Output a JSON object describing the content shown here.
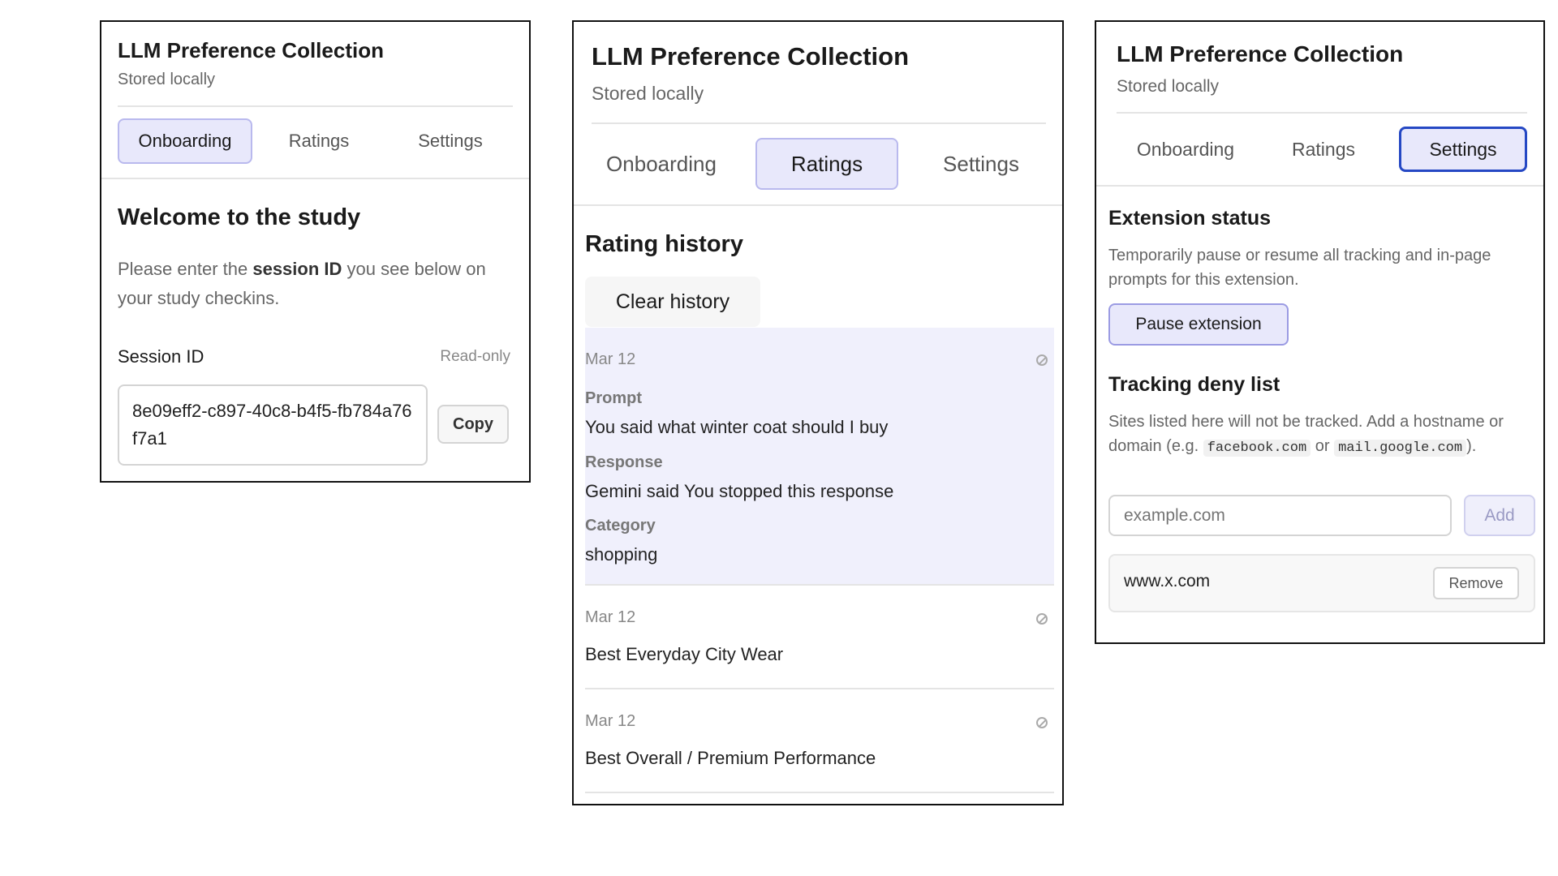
{
  "app": {
    "title": "LLM Preference Collection",
    "subtitle": "Stored locally"
  },
  "tabs": [
    "Onboarding",
    "Ratings",
    "Settings"
  ],
  "onboarding": {
    "heading": "Welcome to the study",
    "text_before": "Please enter the ",
    "text_bold": "session ID",
    "text_after": " you see below on your study checkins.",
    "session_label": "Session ID",
    "readonly_label": "Read-only",
    "session_value": "8e09eff2-c897-40c8-b4f5-fb784a76f7a1",
    "copy_label": "Copy"
  },
  "ratings": {
    "heading": "Rating history",
    "clear_label": "Clear history",
    "items": [
      {
        "date": "Mar 12",
        "prompt_label": "Prompt",
        "prompt": "You said what winter coat should I buy",
        "response_label": "Response",
        "response": "Gemini said You stopped this response",
        "category_label": "Category",
        "category": "shopping"
      },
      {
        "date": "Mar 12",
        "text": "Best Everyday City Wear"
      },
      {
        "date": "Mar 12",
        "text": "Best Overall / Premium Performance"
      }
    ]
  },
  "settings": {
    "status_heading": "Extension status",
    "status_text": "Temporarily pause or resume all tracking and in-page prompts for this extension.",
    "pause_label": "Pause extension",
    "deny_heading": "Tracking deny list",
    "deny_text_1": "Sites listed here will not be tracked. Add a hostname or domain (e.g. ",
    "deny_code_1": "facebook.com",
    "deny_text_2": " or ",
    "deny_code_2": "mail.google.com",
    "deny_text_3": ").",
    "input_placeholder": "example.com",
    "add_label": "Add",
    "deny_items": [
      {
        "host": "www.x.com",
        "remove_label": "Remove"
      }
    ]
  },
  "colors": {
    "accent_bg": "#e8e8fb",
    "accent_border": "#b9b9ee",
    "focus_ring": "#2548c4",
    "highlight_row": "#f0f0fc"
  }
}
